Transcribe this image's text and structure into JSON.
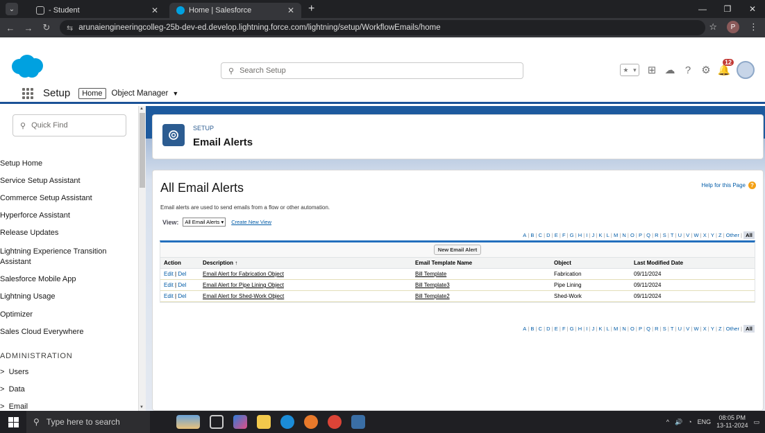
{
  "browser": {
    "tabs": [
      {
        "title": "- Student",
        "active": false
      },
      {
        "title": "Home | Salesforce",
        "active": true
      }
    ],
    "new_tab": "+",
    "url": "arunaiengineeringcolleg-25b-dev-ed.develop.lightning.force.com/lightning/setup/WorkflowEmails/home",
    "profile_initial": "P"
  },
  "header": {
    "search_placeholder": "Search Setup",
    "notification_count": "12"
  },
  "app_nav": {
    "app_name": "Setup",
    "home": "Home",
    "object_manager": "Object Manager"
  },
  "sidebar": {
    "quick_find": "Quick Find",
    "items": [
      "Setup Home",
      "Service Setup Assistant",
      "Commerce Setup Assistant",
      "Hyperforce Assistant",
      "Release Updates",
      "Lightning Experience Transition Assistant",
      "Salesforce Mobile App",
      "Lightning Usage",
      "Optimizer",
      "Sales Cloud Everywhere"
    ],
    "heading": "ADMINISTRATION",
    "sections": [
      "Users",
      "Data",
      "Email"
    ]
  },
  "setup_header": {
    "eyebrow": "SETUP",
    "title": "Email Alerts"
  },
  "page": {
    "heading": "All Email Alerts",
    "help": "Help for this Page",
    "intro": "Email alerts are used to send emails from a flow or other automation.",
    "view_label": "View:",
    "view_selected": "All Email Alerts",
    "create_view": "Create New View",
    "alphabet": [
      "A",
      "B",
      "C",
      "D",
      "E",
      "F",
      "G",
      "H",
      "I",
      "J",
      "K",
      "L",
      "M",
      "N",
      "O",
      "P",
      "Q",
      "R",
      "S",
      "T",
      "U",
      "V",
      "W",
      "X",
      "Y",
      "Z",
      "Other"
    ],
    "all_label": "All",
    "new_button": "New Email Alert",
    "columns": [
      "Action",
      "Description ↑",
      "Email Template Name",
      "Object",
      "Last Modified Date"
    ],
    "rows": [
      {
        "edit": "Edit",
        "del": "Del",
        "description": "Email Alert for Fabrication Object",
        "template": "Bill Template",
        "object": "Fabrication",
        "modified": "09/11/2024"
      },
      {
        "edit": "Edit",
        "del": "Del",
        "description": "Email Alert for Pipe Lining Object",
        "template": "Bill Template3",
        "object": "Pipe Lining",
        "modified": "09/11/2024"
      },
      {
        "edit": "Edit",
        "del": "Del",
        "description": "Email Alert for Shed-Work Object",
        "template": "Bill Template2",
        "object": "Shed-Work",
        "modified": "09/11/2024"
      }
    ]
  },
  "taskbar": {
    "search_placeholder": "Type here to search",
    "language": "ENG",
    "time": "08:05 PM",
    "date": "13-11-2024"
  },
  "colors": {
    "brand": "#00a1e0",
    "nav_blue": "#1b5297",
    "link": "#015ba7"
  }
}
